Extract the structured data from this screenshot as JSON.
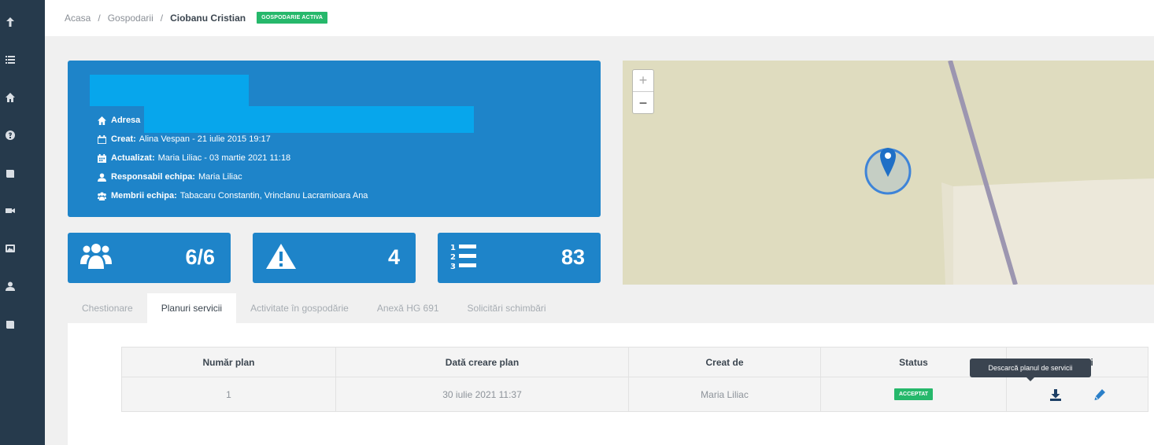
{
  "sidebar": {
    "icons": [
      "up-arrow-icon",
      "list-icon",
      "home-icon",
      "help-icon",
      "book-icon",
      "video-icon",
      "image-icon",
      "user-icon",
      "book-icon"
    ]
  },
  "breadcrumb": {
    "home": "Acasa",
    "section": "Gospodarii",
    "current": "Ciobanu Cristian",
    "status_badge": "GOSPODARIE ACTIVA"
  },
  "info": {
    "address_label": "Adresa",
    "created_label": "Creat:",
    "created_value": "Alina Vespan - 21 iulie 2015 19:17",
    "updated_label": "Actualizat:",
    "updated_value": "Maria Liliac - 03 martie 2021 11:18",
    "responsible_label": "Responsabil echipa:",
    "responsible_value": "Maria Liliac",
    "members_label": "Membrii echipa:",
    "members_value": "Tabacaru Constantin, Vrinclanu Lacramioara Ana"
  },
  "stats": [
    {
      "icon": "users-icon",
      "value": "6/6"
    },
    {
      "icon": "warning-icon",
      "value": "4"
    },
    {
      "icon": "numbered-list-icon",
      "value": "83"
    }
  ],
  "map": {
    "zoom_in": "+",
    "zoom_out": "−"
  },
  "tabs": [
    {
      "label": "Chestionare",
      "active": false
    },
    {
      "label": "Planuri servicii",
      "active": true
    },
    {
      "label": "Activitate în gospodărie",
      "active": false
    },
    {
      "label": "Anexă HG 691",
      "active": false
    },
    {
      "label": "Solicitări schimbări",
      "active": false
    }
  ],
  "table": {
    "columns": [
      "Număr plan",
      "Dată creare plan",
      "Creat de",
      "Status",
      "Acțiuni"
    ],
    "rows": [
      {
        "number": "1",
        "date": "30 iulie 2021 11:37",
        "author": "Maria Liliac",
        "status": "ACCEPTAT"
      }
    ]
  },
  "tooltip": "Descarcă planul de servicii",
  "colors": {
    "primary": "#1e84c9",
    "success": "#26b86b",
    "sidebar": "#263a4c"
  }
}
